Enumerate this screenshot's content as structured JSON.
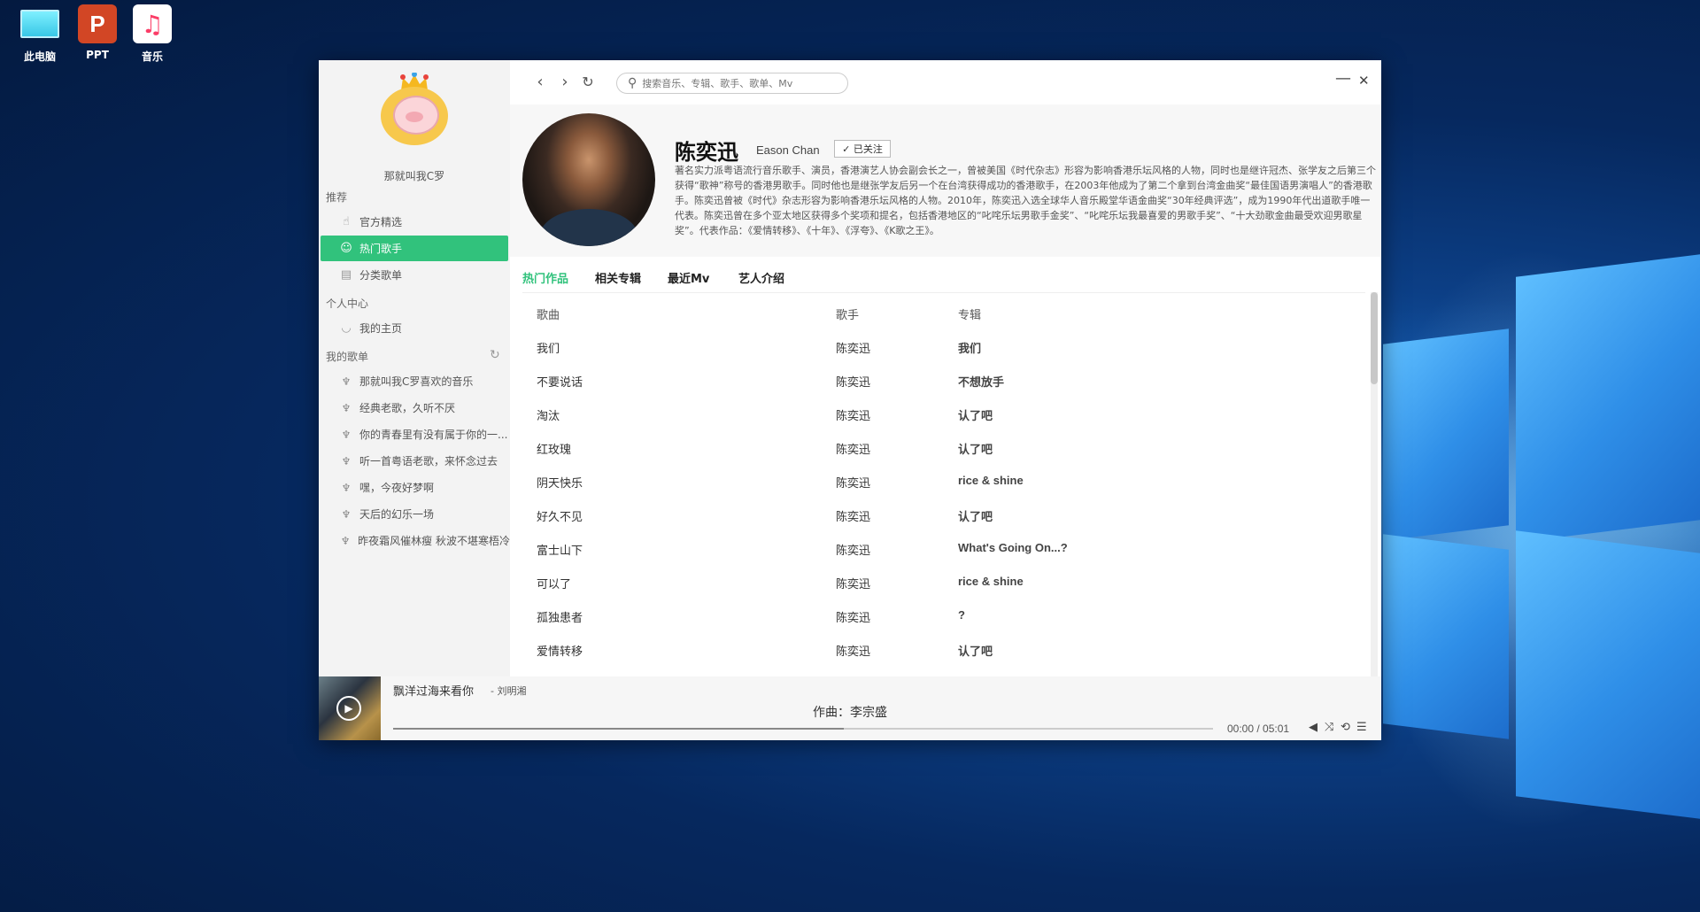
{
  "desktop": {
    "icons": [
      {
        "label": "此电脑",
        "icon": "computer-icon"
      },
      {
        "label": "PPT",
        "icon": "powerpoint-icon",
        "glyph": "P"
      },
      {
        "label": "音乐",
        "icon": "music-icon",
        "glyph": "♫"
      }
    ]
  },
  "sidebar": {
    "user_name": "那就叫我C罗",
    "sections": {
      "recommend": "推荐",
      "personal": "个人中心",
      "my_playlists": "我的歌单"
    },
    "recommend_items": [
      {
        "label": "官方精选",
        "icon": "hand-icon",
        "active": false
      },
      {
        "label": "热门歌手",
        "icon": "user-icon",
        "active": true
      },
      {
        "label": "分类歌单",
        "icon": "book-icon",
        "active": false
      }
    ],
    "personal_items": [
      {
        "label": "我的主页",
        "icon": "smile-icon"
      }
    ],
    "playlists": [
      "那就叫我C罗喜欢的音乐",
      "经典老歌，久听不厌",
      "你的青春里有没有属于你的一...",
      "听一首粤语老歌，来怀念过去",
      "嘿，今夜好梦啊",
      "天后的幻乐一场",
      "昨夜霜风催林瘦 秋波不堪寒梧冷"
    ]
  },
  "topbar": {
    "search_placeholder": "搜索音乐、专辑、歌手、歌单、Mv",
    "back_glyph": "‹",
    "forward_glyph": "›",
    "refresh_glyph": "↻",
    "minimize_glyph": "—",
    "close_glyph": "✕"
  },
  "artist": {
    "name": "陈奕迅",
    "english_name": "Eason Chan",
    "follow_label": "✓ 已关注",
    "description": "著名实力派粤语流行音乐歌手、演员，香港演艺人协会副会长之一，曾被美国《时代杂志》形容为影响香港乐坛风格的人物，同时也是继许冠杰、张学友之后第三个获得“歌神”称号的香港男歌手。同时他也是继张学友后另一个在台湾获得成功的香港歌手，在2003年他成为了第二个拿到台湾金曲奖“最佳国语男演唱人”的香港歌手。陈奕迅曾被《时代》杂志形容为影响香港乐坛风格的人物。2010年，陈奕迅入选全球华人音乐殿堂华语金曲奖“30年经典评选”，成为1990年代出道歌手唯一代表。陈奕迅曾在多个亚太地区获得多个奖项和提名，包括香港地区的“叱咤乐坛男歌手金奖”、“叱咤乐坛我最喜爱的男歌手奖”、“十大劲歌金曲最受欢迎男歌星奖”。代表作品：《爱情转移》、《十年》、《浮夸》、《K歌之王》。"
  },
  "tabs": [
    {
      "label": "热门作品",
      "active": true
    },
    {
      "label": "相关专辑",
      "active": false
    },
    {
      "label": "最近Mv",
      "active": false
    },
    {
      "label": "艺人介绍",
      "active": false
    }
  ],
  "songs_table": {
    "headers": [
      "歌曲",
      "歌手",
      "专辑"
    ],
    "rows": [
      [
        "我们",
        "陈奕迅",
        "我们"
      ],
      [
        "不要说话",
        "陈奕迅",
        "不想放手"
      ],
      [
        "淘汰",
        "陈奕迅",
        "认了吧"
      ],
      [
        "红玫瑰",
        "陈奕迅",
        "认了吧"
      ],
      [
        "阴天快乐",
        "陈奕迅",
        "rice & shine"
      ],
      [
        "好久不见",
        "陈奕迅",
        "认了吧"
      ],
      [
        "富士山下",
        "陈奕迅",
        "What's Going On...?"
      ],
      [
        "可以了",
        "陈奕迅",
        "rice & shine"
      ],
      [
        "孤独患者",
        "陈奕迅",
        "?"
      ],
      [
        "爱情转移",
        "陈奕迅",
        "认了吧"
      ]
    ]
  },
  "player": {
    "song_title": "飘洋过海来看你",
    "song_artist": "- 刘明湘",
    "lyric": "作曲：李宗盛",
    "time": "00:00 / 05:01",
    "progress": 0.55,
    "controls": [
      "volume-icon",
      "shuffle-icon",
      "repeat-icon",
      "playlist-icon"
    ]
  },
  "colors": {
    "accent": "#31c27c",
    "sidebar_bg": "#f3f3f3",
    "desktop_bg": "#0c3f86"
  }
}
